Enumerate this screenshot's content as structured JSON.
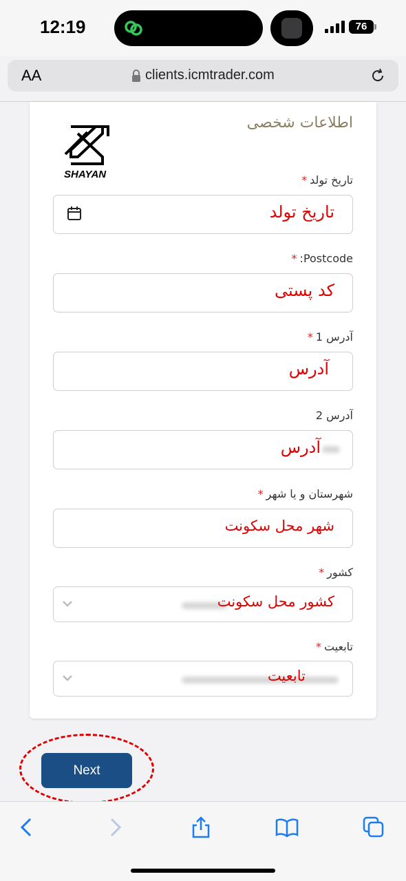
{
  "status_bar": {
    "time": "12:19",
    "battery": "76"
  },
  "browser": {
    "text_size_button": "AA",
    "url": "clients.icmtrader.com"
  },
  "form": {
    "section_title": "اطلاعات شخصی",
    "logo_text": "SHAYAN",
    "required_mark": "*",
    "fields": [
      {
        "label": "تاریخ تولد",
        "required": true,
        "value": "تاریخ تولد"
      },
      {
        "label": "Postcode:",
        "required": true,
        "value": "کد پستی"
      },
      {
        "label": "آدرس 1",
        "required": true,
        "value": "آدرس"
      },
      {
        "label": "آدرس 2",
        "required": false,
        "value": "آدرس"
      },
      {
        "label": "شهرستان و یا شهر",
        "required": true,
        "value": "شهر محل سکونت"
      },
      {
        "label": "کشور",
        "required": true,
        "value": "کشور محل سکونت"
      },
      {
        "label": "تابعیت",
        "required": true,
        "value": "تابعیت"
      }
    ]
  },
  "next_button": {
    "label": "Next"
  },
  "colors": {
    "accent": "#1b4e84",
    "annotation": "#e00000",
    "section_title": "#8a8060"
  },
  "icons": [
    "calendar-icon",
    "chevron-down-icon",
    "lock-icon",
    "reload-icon",
    "back-icon",
    "forward-icon",
    "share-icon",
    "bookmarks-icon",
    "tabs-icon"
  ]
}
